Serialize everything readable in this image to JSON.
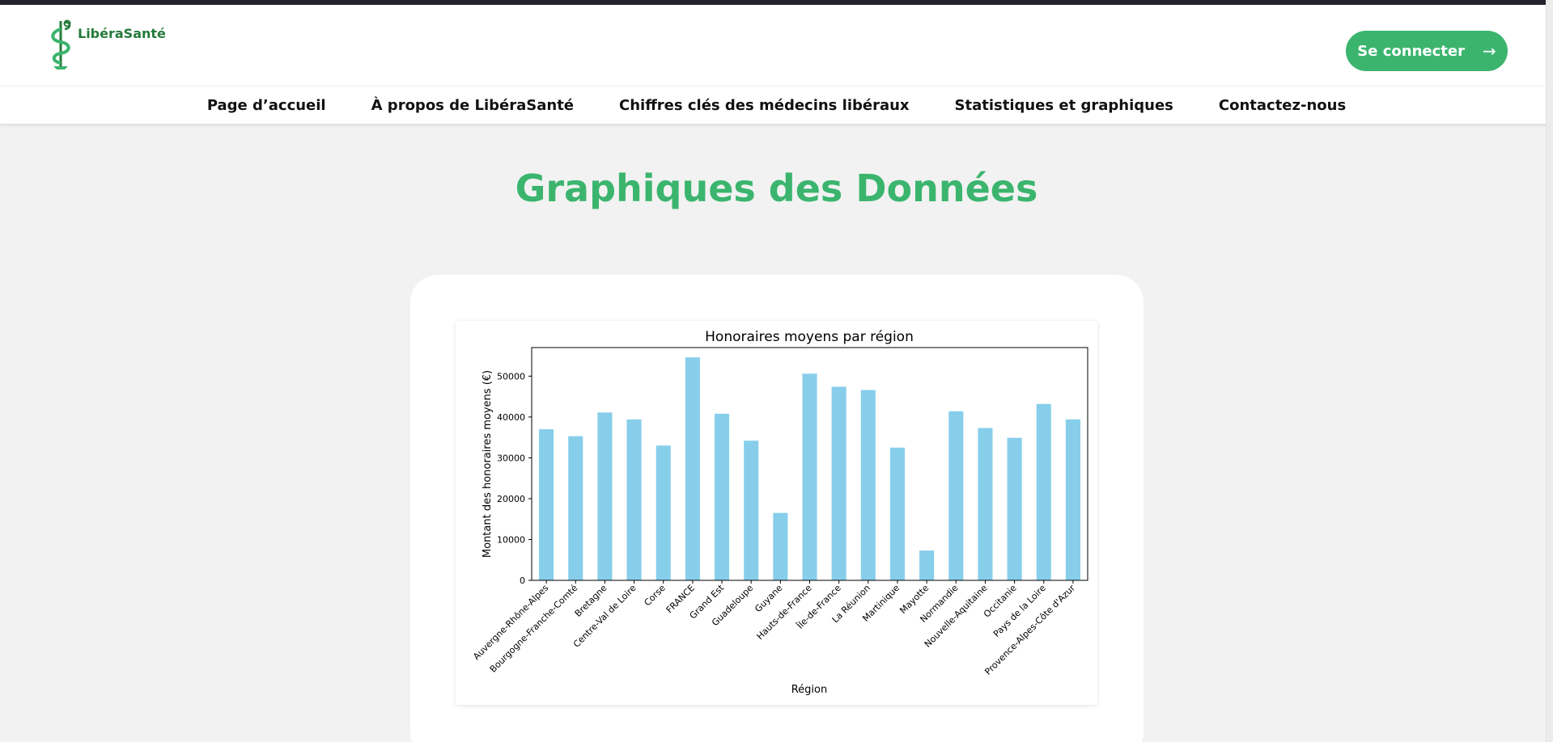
{
  "brand": {
    "name": "LibéraSanté",
    "logo_icon": "caduceus-icon"
  },
  "header": {
    "login_label": "Se connecter",
    "login_arrow": "→"
  },
  "nav": {
    "items": [
      {
        "label": "Page d’accueil"
      },
      {
        "label": "À propos de LibéraSanté"
      },
      {
        "label": "Chiffres clés des médecins libéraux"
      },
      {
        "label": "Statistiques et graphiques"
      },
      {
        "label": "Contactez-nous"
      }
    ]
  },
  "main": {
    "title": "Graphiques des Données"
  },
  "colors": {
    "accent": "#3bb56e",
    "logo_green": "#247a3a",
    "bar": "#87ceeb"
  },
  "chart_data": {
    "type": "bar",
    "title": "Honoraires moyens par région",
    "xlabel": "Région",
    "ylabel": "Montant des honoraires moyens (€)",
    "ylim": [
      0,
      57000
    ],
    "yticks": [
      0,
      10000,
      20000,
      30000,
      40000,
      50000
    ],
    "grid": false,
    "categories": [
      "Auvergne-Rhône-Alpes",
      "Bourgogne-Franche-Comté",
      "Bretagne",
      "Centre-Val de Loire",
      "Corse",
      "FRANCE",
      "Grand Est",
      "Guadeloupe",
      "Guyane",
      "Hauts-de-France",
      "Île-de-France",
      "La Réunion",
      "Martinique",
      "Mayotte",
      "Normandie",
      "Nouvelle-Aquitaine",
      "Occitanie",
      "Pays de la Loire",
      "Provence-Alpes-Côte d'Azur"
    ],
    "values": [
      37000,
      35300,
      41100,
      39400,
      33000,
      54600,
      40800,
      34200,
      16500,
      50600,
      47400,
      46600,
      32500,
      7300,
      41400,
      37300,
      34900,
      43200,
      39400
    ]
  }
}
